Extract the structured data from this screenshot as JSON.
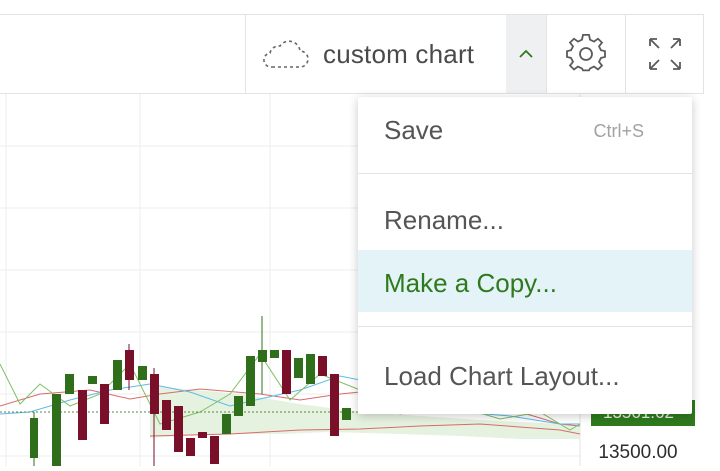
{
  "toolbar": {
    "layout_name": "custom chart",
    "icons": {
      "layout": "cloud-icon",
      "menu_toggle": "chevron-up-icon",
      "settings": "gear-icon",
      "fullscreen": "fullscreen-icon"
    },
    "accent_color": "#2f7a1d"
  },
  "menu": {
    "items": [
      {
        "label": "Save",
        "shortcut": "Ctrl+S"
      },
      {
        "label": "Rename..."
      },
      {
        "label": "Make a Copy..."
      },
      {
        "label": "Load Chart Layout..."
      }
    ],
    "highlighted": "Make a Copy..."
  },
  "price_axis": {
    "current_price": "13561.62",
    "visible_label": "13500.00"
  },
  "chart_colors": {
    "up": "#2f6f1c",
    "down": "#7a0f2a",
    "cloud_fill": "#e6f2e0",
    "line_blue": "#5bbbe8",
    "line_red": "#d86b6b"
  }
}
